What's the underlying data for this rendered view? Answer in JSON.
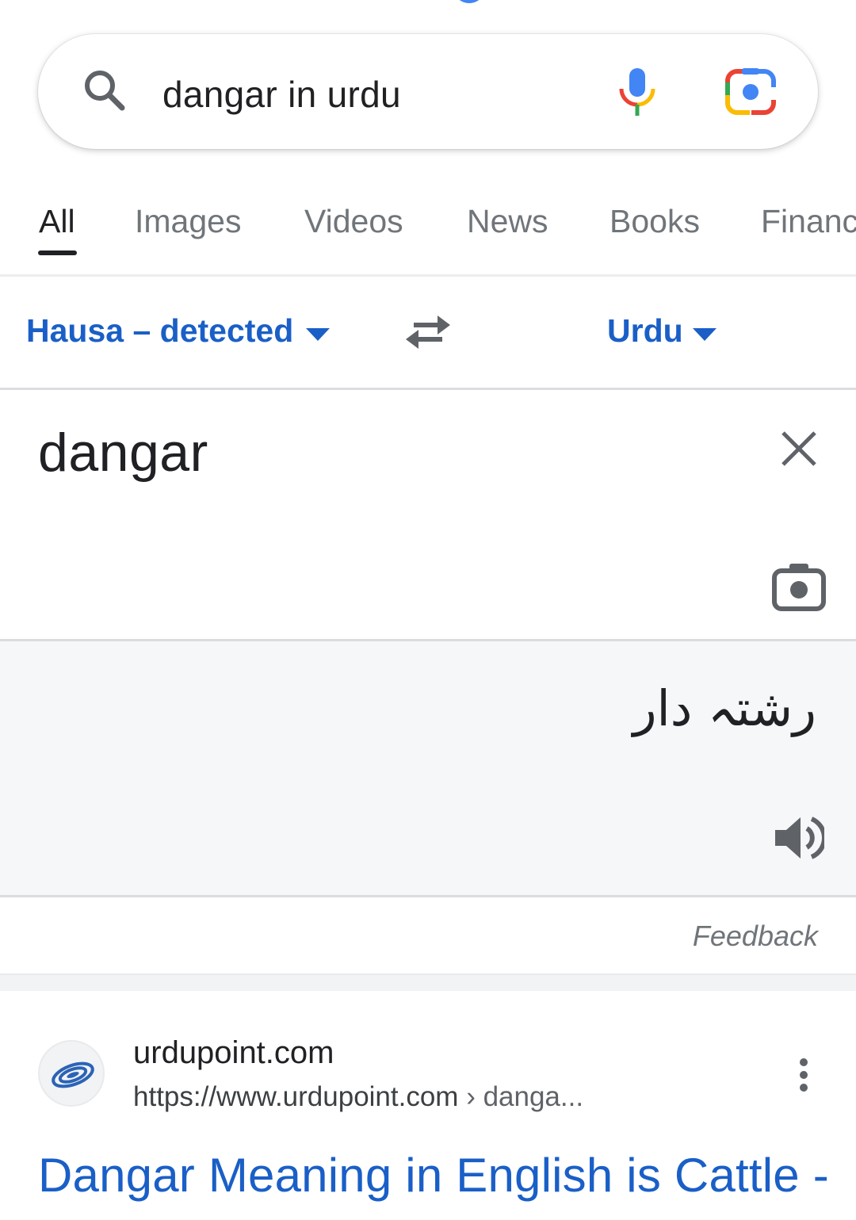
{
  "search": {
    "query": "dangar in urdu"
  },
  "tabs": [
    {
      "label": "All",
      "active": true
    },
    {
      "label": "Images",
      "active": false
    },
    {
      "label": "Videos",
      "active": false
    },
    {
      "label": "News",
      "active": false
    },
    {
      "label": "Books",
      "active": false
    },
    {
      "label": "Finance",
      "active": false
    }
  ],
  "translate": {
    "source_language": "Hausa – detected",
    "target_language": "Urdu",
    "source_text": "dangar",
    "translated_text": "رشتہ دار",
    "feedback_label": "Feedback"
  },
  "result": {
    "site_name": "urdupoint.com",
    "url_base": "https://www.urdupoint.com",
    "url_path": " › danga...",
    "title": "Dangar Meaning in English is Cattle -"
  },
  "colors": {
    "link_blue": "#1a5fc7",
    "text_dark": "#202124",
    "text_gray": "#70757a",
    "target_bg": "#f6f7f9"
  },
  "icons": {
    "search": "search-icon",
    "mic": "microphone-icon",
    "lens": "google-lens-icon",
    "swap": "swap-languages-icon",
    "close": "close-icon",
    "camera": "camera-icon",
    "speaker": "speaker-icon",
    "more": "more-vert-icon"
  }
}
